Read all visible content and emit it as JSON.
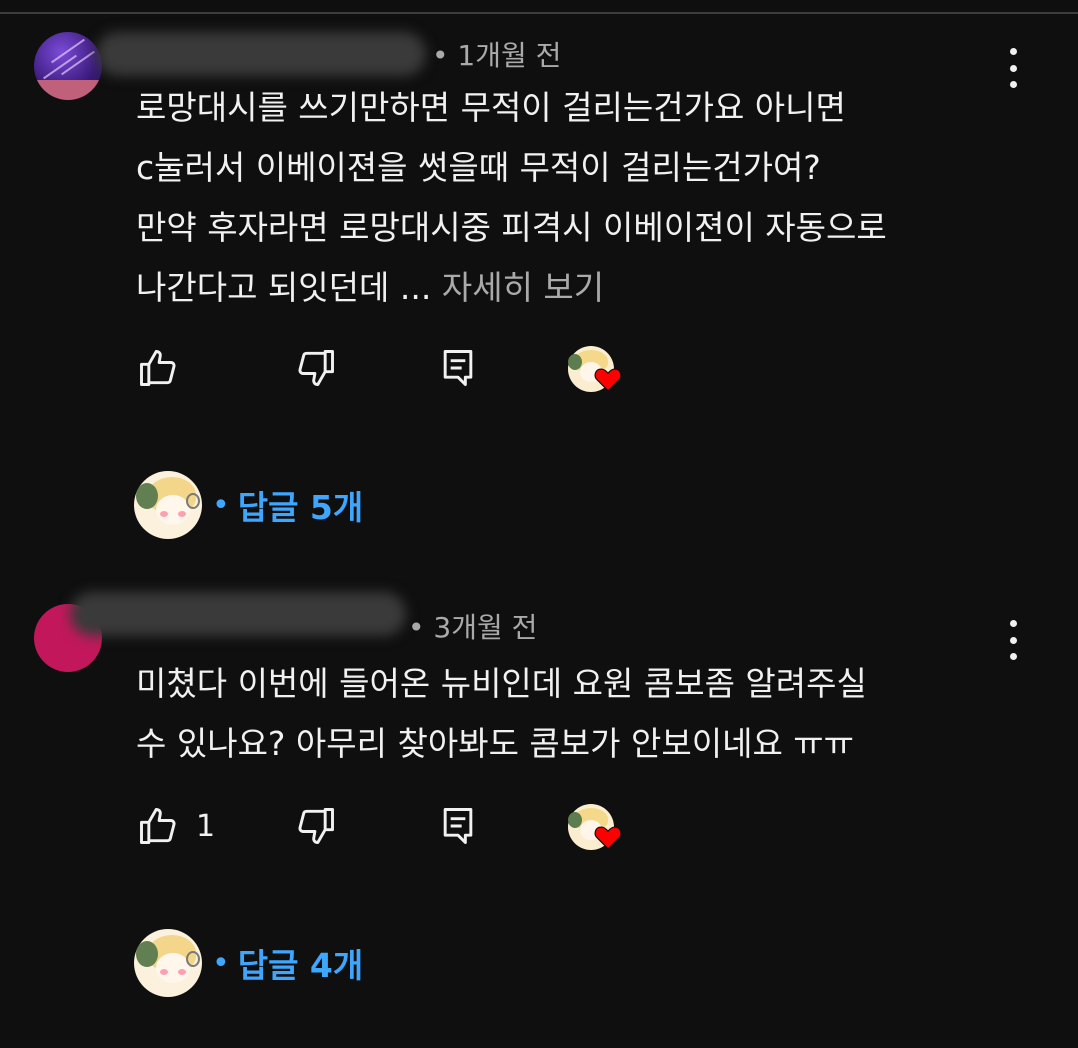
{
  "theme": {
    "background": "#0f0f0f",
    "text": "#f1f1f1",
    "secondary_text": "#aaaaaa",
    "link_blue": "#3ea6ff",
    "heart_red": "#ff0000"
  },
  "comments": [
    {
      "author_visible": false,
      "avatar_icon": "galaxy-avatar-icon",
      "time_prefix": "• ",
      "time": "1개월 전",
      "lines": [
        "로망대시를 쓰기만하면 무적이 걸리는건가요 아니면",
        "c눌러서 이베이젼을 썻을때 무적이 걸리는건가여?",
        "만약 후자라면 로망대시중 피격시 이베이젼이 자동으로",
        "나간다고 되잇던데 ..."
      ],
      "read_more": "자세히 보기",
      "like_count": "",
      "actions": {
        "like_icon": "thumbs-up-icon",
        "dislike_icon": "thumbs-down-icon",
        "reply_icon": "reply-comment-icon",
        "creator_heart_icon": "creator-heart-icon"
      },
      "replies_label": "답글 5개"
    },
    {
      "author_visible": false,
      "avatar_icon": "pink-avatar-icon",
      "time_prefix": "• ",
      "time": "3개월 전",
      "lines": [
        "미쳤다 이번에 들어온 뉴비인데 요원 콤보좀 알려주실",
        "수 있나요? 아무리 찾아봐도 콤보가 안보이네요 ㅠㅠ"
      ],
      "read_more": "",
      "like_count": "1",
      "actions": {
        "like_icon": "thumbs-up-icon",
        "dislike_icon": "thumbs-down-icon",
        "reply_icon": "reply-comment-icon",
        "creator_heart_icon": "creator-heart-icon"
      },
      "replies_label": "답글 4개"
    }
  ],
  "replies_dot": "•"
}
